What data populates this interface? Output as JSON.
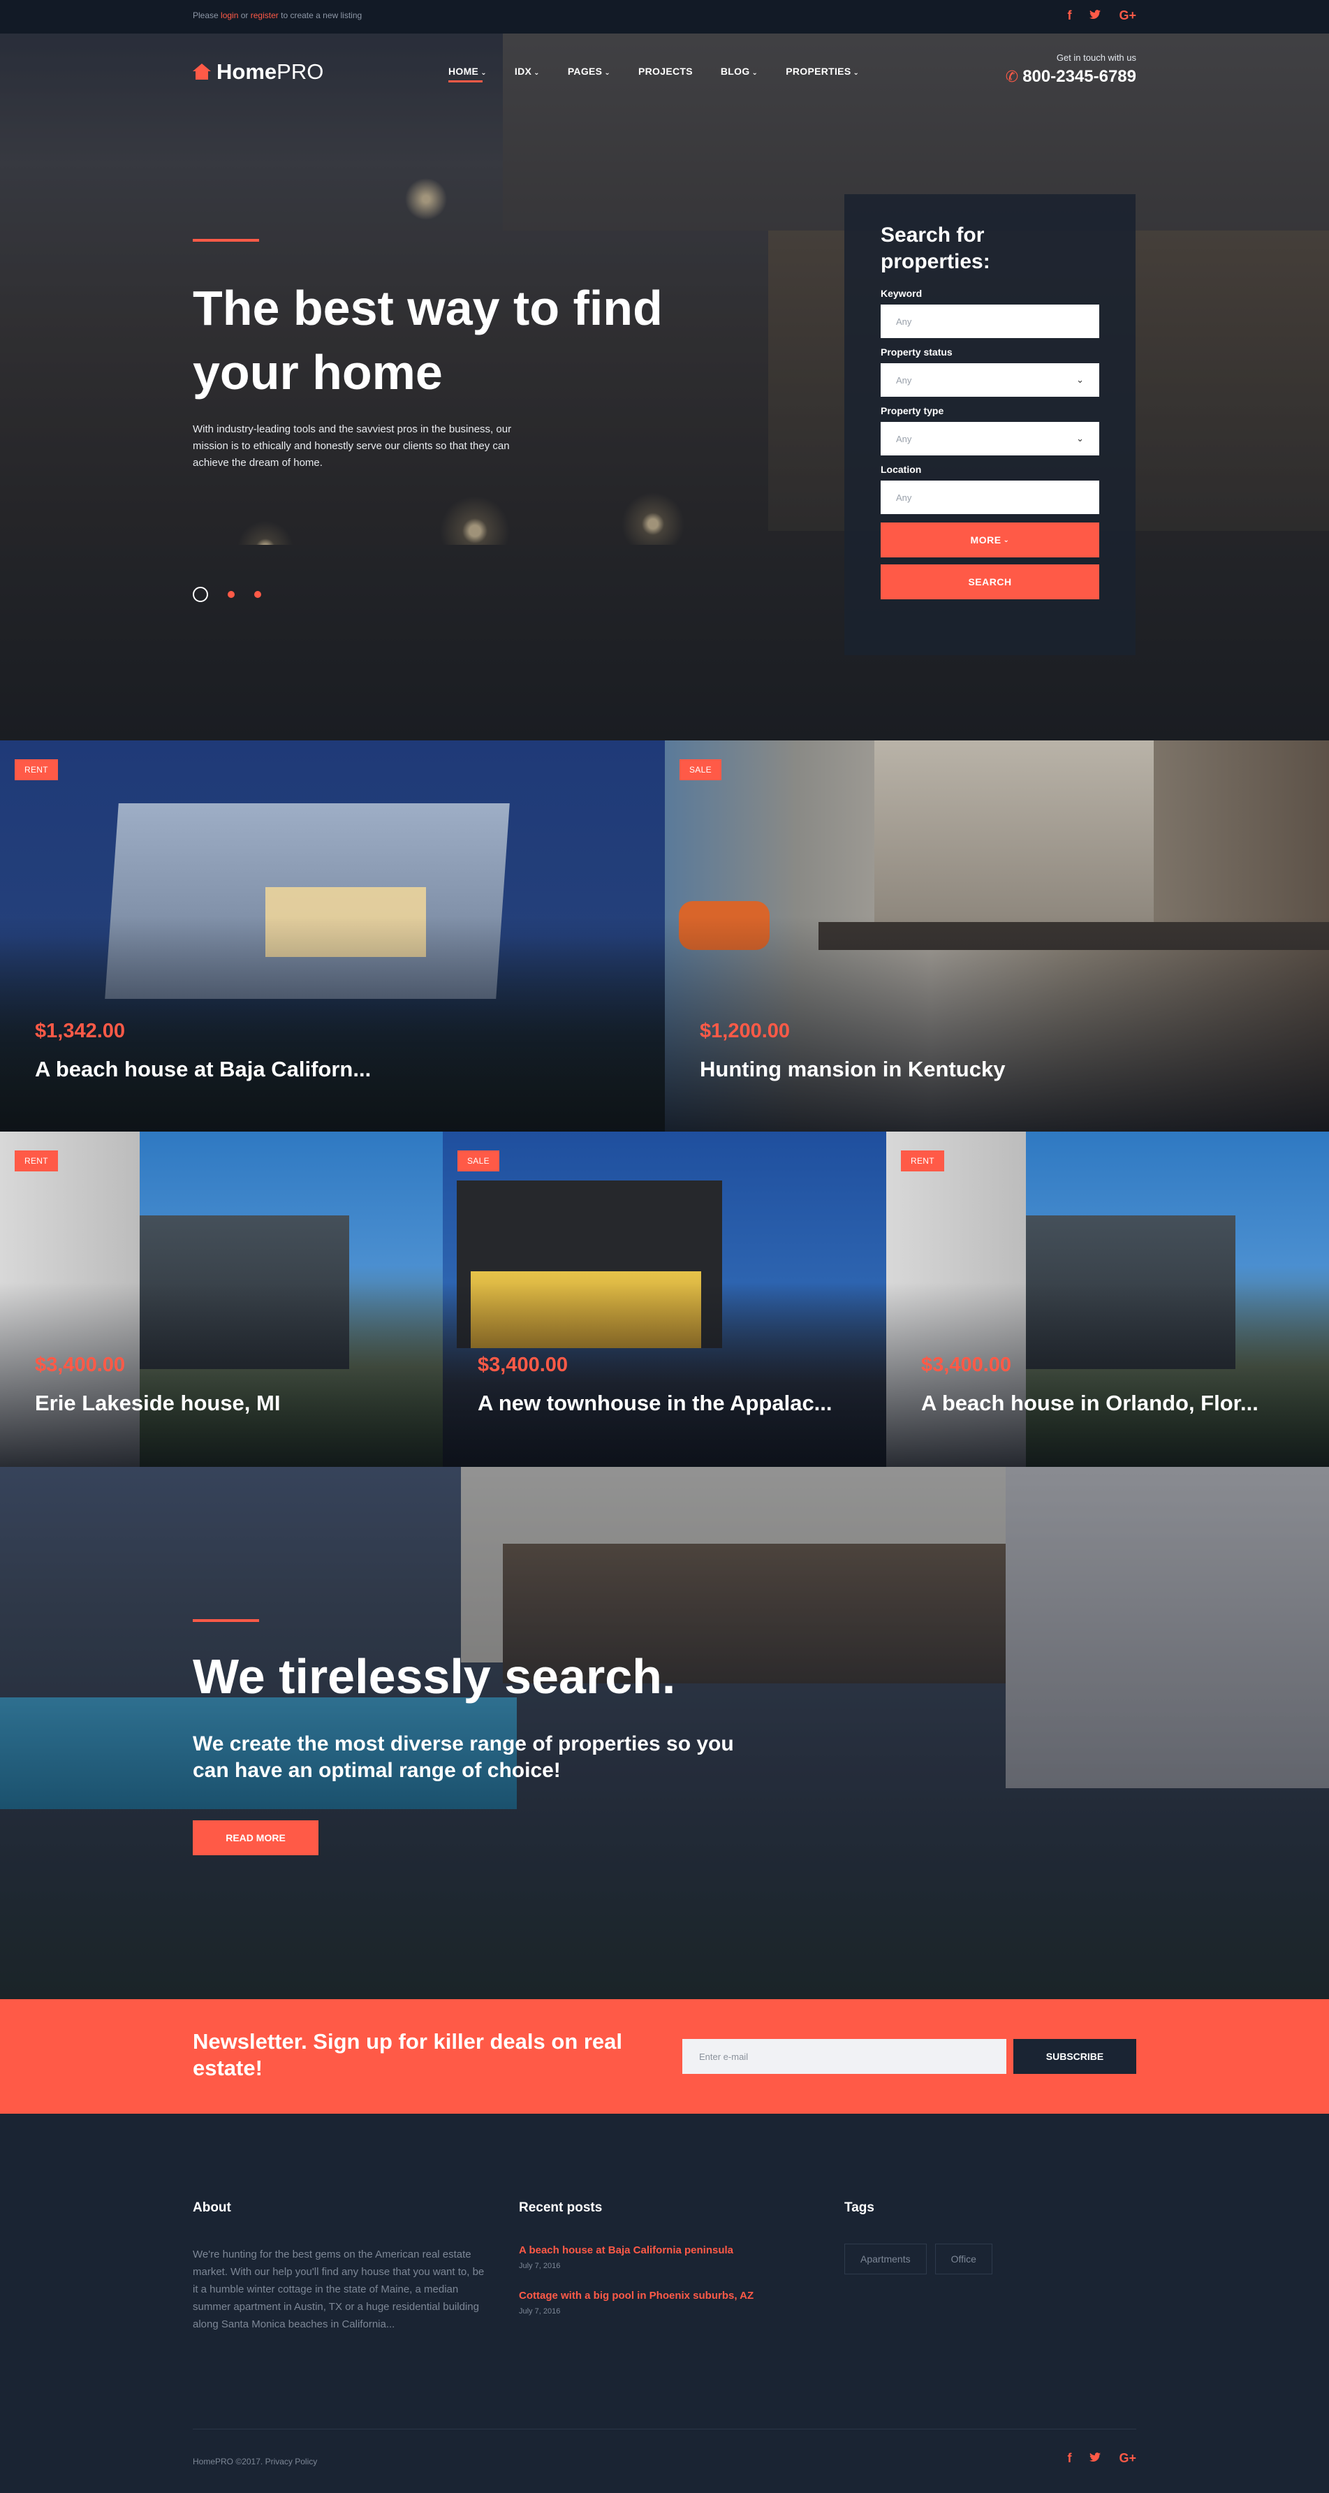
{
  "topbar": {
    "pre": "Please",
    "login": "login",
    "or": "or",
    "register": "register",
    "post": "to create a new listing"
  },
  "social": [
    "f",
    "t",
    "G+"
  ],
  "brand": {
    "bold": "Home",
    "light": "PRO"
  },
  "nav": [
    {
      "label": "HOME",
      "dropdown": true
    },
    {
      "label": "IDX",
      "dropdown": true
    },
    {
      "label": "PAGES",
      "dropdown": true
    },
    {
      "label": "PROJECTS",
      "dropdown": false
    },
    {
      "label": "BLOG",
      "dropdown": true
    },
    {
      "label": "PROPERTIES",
      "dropdown": true
    }
  ],
  "contact": {
    "label": "Get in touch with us",
    "phone": "800-2345-6789"
  },
  "hero": {
    "title": "The best way to find your home",
    "description": "With industry-leading tools and the savviest pros in the business, our mission is to ethically and honestly serve our clients so that they can achieve the dream of home."
  },
  "search": {
    "title": "Search for properties:",
    "keyword": {
      "label": "Keyword",
      "placeholder": "Any"
    },
    "status": {
      "label": "Property status",
      "value": "Any"
    },
    "type": {
      "label": "Property type",
      "value": "Any"
    },
    "location": {
      "label": "Location",
      "placeholder": "Any"
    },
    "more_label": "MORE",
    "search_label": "SEARCH"
  },
  "properties": [
    {
      "badge": "RENT",
      "price": "$1,342.00",
      "title": "A beach house at Baja Californ..."
    },
    {
      "badge": "SALE",
      "price": "$1,200.00",
      "title": "Hunting mansion in Kentucky"
    },
    {
      "badge": "RENT",
      "price": "$3,400.00",
      "title": "Erie Lakeside house, MI"
    },
    {
      "badge": "SALE",
      "price": "$3,400.00",
      "title": "A new townhouse in the Appalac..."
    },
    {
      "badge": "RENT",
      "price": "$3,400.00",
      "title": "A beach house in Orlando, Flor..."
    }
  ],
  "about": {
    "title": "We tirelessly search.",
    "subtitle": "We create the most diverse range of properties so you can have an optimal range of choice!",
    "button": "READ MORE"
  },
  "newsletter": {
    "title": "Newsletter. Sign up for killer deals on real estate!",
    "placeholder": "Enter e-mail",
    "button": "SUBSCRIBE"
  },
  "footer": {
    "about_heading": "About",
    "about_text": "We're hunting for the best gems on the American real estate market. With our help you'll find any house that you want to, be it a humble winter cottage in the state of Maine, a median summer apartment in Austin, TX or a huge residential building along Santa Monica beaches in California...",
    "posts_heading": "Recent posts",
    "posts": [
      {
        "title": "A beach house at Baja California peninsula",
        "date": "July 7, 2016"
      },
      {
        "title": "Cottage with a big pool in Phoenix suburbs, AZ",
        "date": "July 7, 2016"
      }
    ],
    "tags_heading": "Tags",
    "tags": [
      "Apartments",
      "Office"
    ],
    "copyright": "HomePRO ©2017.",
    "privacy": "Privacy Policy"
  },
  "colors": {
    "accent": "#ff5a47",
    "dark": "#1a2433"
  }
}
